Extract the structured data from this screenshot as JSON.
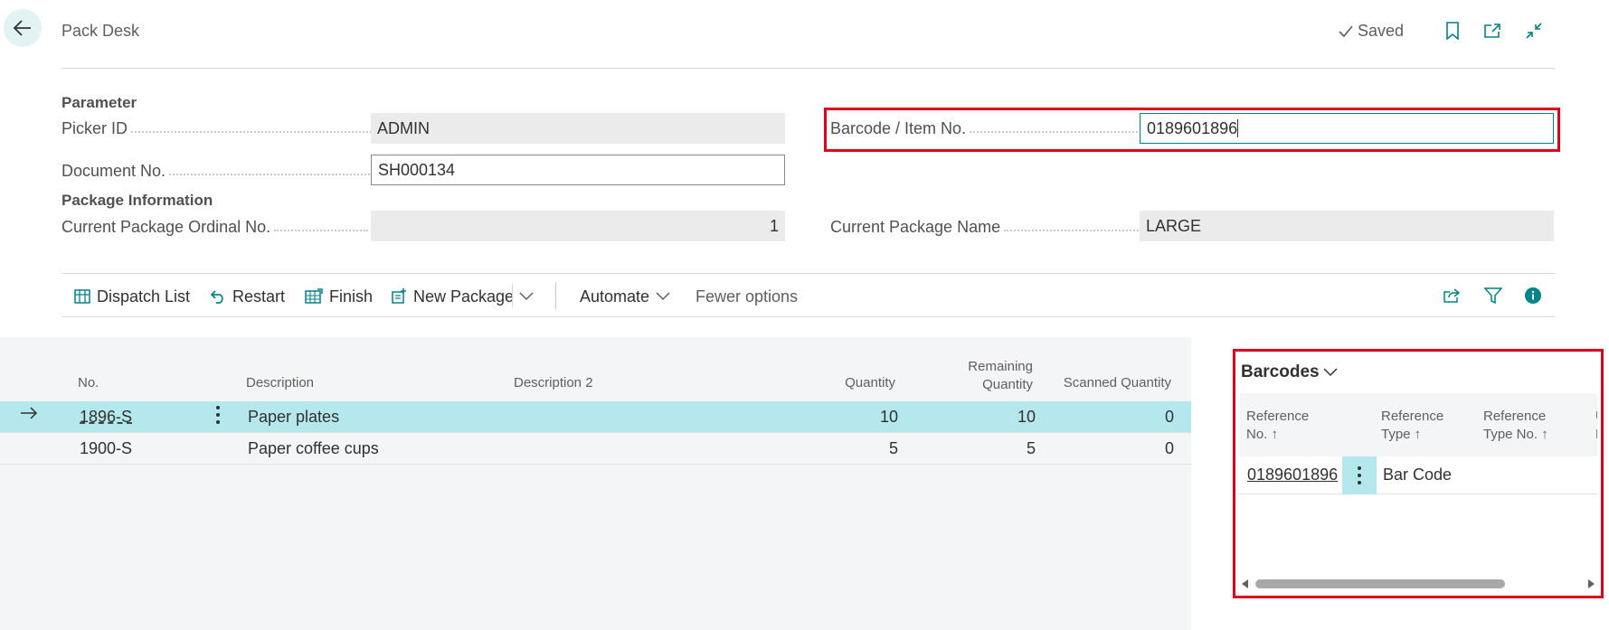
{
  "header": {
    "title": "Pack Desk",
    "saved_label": "Saved",
    "icons": {
      "back": "back-arrow-icon",
      "bookmark": "bookmark-icon",
      "open_new": "open-in-new-window-icon",
      "collapse": "collapse-icon"
    }
  },
  "parameter": {
    "section_title": "Parameter",
    "picker_id": {
      "label": "Picker ID",
      "value": "ADMIN"
    },
    "document_no": {
      "label": "Document No.",
      "value": "SH000134"
    },
    "barcode_item_no": {
      "label": "Barcode / Item No.",
      "value": "0189601896"
    }
  },
  "package_info": {
    "section_title": "Package Information",
    "ordinal_no": {
      "label": "Current Package Ordinal No.",
      "value": "1"
    },
    "package_name": {
      "label": "Current Package Name",
      "value": "LARGE"
    }
  },
  "toolbar": {
    "dispatch_list": "Dispatch List",
    "restart": "Restart",
    "finish": "Finish",
    "new_package": "New Package",
    "automate": "Automate",
    "fewer_options": "Fewer options",
    "right_icons": [
      "share-icon",
      "filter-icon",
      "info-icon"
    ]
  },
  "lines": {
    "columns": {
      "no": "No.",
      "description": "Description",
      "description2": "Description 2",
      "quantity": "Quantity",
      "remaining_1": "Remaining",
      "remaining_2": "Quantity",
      "scanned": "Scanned Quantity"
    },
    "rows": [
      {
        "no": "1896-S",
        "description": "Paper plates",
        "description2": "",
        "quantity": "10",
        "remaining": "10",
        "scanned": "0",
        "selected": true
      },
      {
        "no": "1900-S",
        "description": "Paper coffee cups",
        "description2": "",
        "quantity": "5",
        "remaining": "5",
        "scanned": "0",
        "selected": false
      }
    ]
  },
  "barcodes": {
    "title": "Barcodes",
    "columns": {
      "ref_no_1": "Reference",
      "ref_no_2": "No. ↑",
      "ref_type_1": "Reference",
      "ref_type_2": "Type ↑",
      "ref_type_no_1": "Reference",
      "ref_type_no_2": "Type No. ↑",
      "next_1": "U",
      "next_2": "N"
    },
    "rows": [
      {
        "reference_no": "0189601896",
        "reference_type": "Bar Code",
        "reference_type_no": "",
        "overflow": "."
      }
    ]
  },
  "colors": {
    "accent": "#008489",
    "selected_row": "#b5e8ec",
    "highlight": "#e0001b"
  }
}
